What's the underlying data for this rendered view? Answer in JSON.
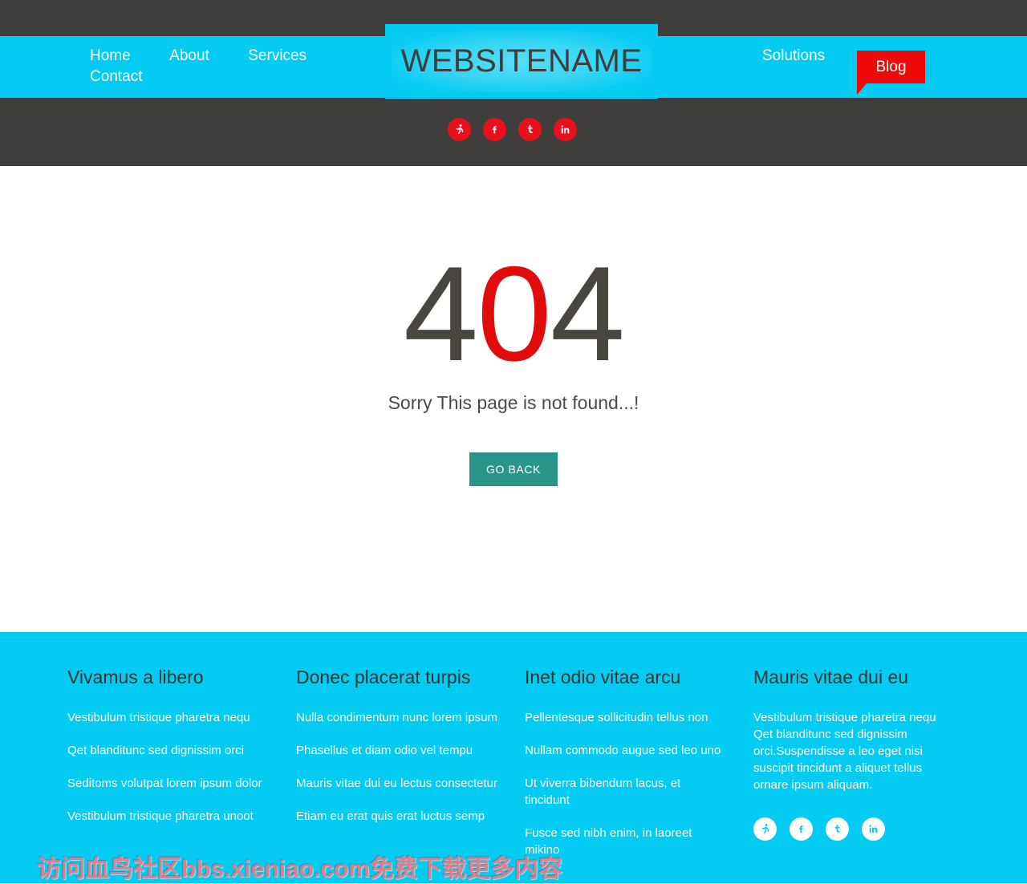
{
  "colors": {
    "cyan": "#04cbf2",
    "dark": "#403e3c",
    "red": "#ee0a0a",
    "social_red": "#e8111b",
    "teal": "#2a9488",
    "error_gray": "#49463f",
    "error_red": "#e20b0b",
    "white": "#ffffff"
  },
  "header": {
    "logo_text": "WEBSITENAME",
    "nav_left": [
      {
        "label": "Home",
        "name": "nav-home"
      },
      {
        "label": "About",
        "name": "nav-about"
      },
      {
        "label": "Services",
        "name": "nav-services"
      },
      {
        "label": "Contact",
        "name": "nav-contact"
      }
    ],
    "nav_right": [
      {
        "label": "Solutions",
        "name": "nav-solutions"
      }
    ],
    "blog_label": "Blog"
  },
  "social_top": [
    {
      "name": "runner-icon",
      "title": "Runner"
    },
    {
      "name": "facebook-icon",
      "title": "Facebook",
      "glyph": "f"
    },
    {
      "name": "twitter-icon",
      "title": "Twitter",
      "glyph": "t"
    },
    {
      "name": "linkedin-icon",
      "title": "LinkedIn",
      "glyph": "in"
    }
  ],
  "main": {
    "error_digit_1": "4",
    "error_digit_2": "0",
    "error_digit_3": "4",
    "message": "Sorry This page is not found...!",
    "go_back_label": "GO BACK"
  },
  "footer": {
    "columns": [
      {
        "title": "Vivamus a libero",
        "links": [
          "Vestibulum tristique pharetra nequ",
          "Qet blanditunc sed dignissim orci",
          "Seditoms volutpat lorem ipsum dolor",
          "Vestibulum tristique pharetra unoot"
        ]
      },
      {
        "title": "Donec placerat turpis",
        "links": [
          "Nulla condimentum nunc lorem ipsum",
          "Phasellus et diam odio vel tempu",
          "Mauris vitae dui eu lectus consectetur",
          "Etiam eu erat quis erat luctus semp"
        ]
      },
      {
        "title": "Inet odio vitae arcu",
        "links": [
          "Pellentesque sollicitudin tellus non",
          "Nullam commodo augue sed leo uno",
          "Ut viverra bibendum lacus, et tincidunt",
          "Fusce sed nibh enim, in laoreet mikino"
        ]
      },
      {
        "title": "Mauris vitae dui eu",
        "paragraph": "Vestibulum tristique pharetra nequ Qet blanditunc sed dignissim orci.Suspendisse a leo eget nisi suscipit tincidunt a aliquet tellus ornare ipsum aliquam."
      }
    ],
    "social": [
      {
        "name": "runner-icon",
        "title": "Runner"
      },
      {
        "name": "facebook-icon",
        "title": "Facebook",
        "glyph": "f"
      },
      {
        "name": "twitter-icon",
        "title": "Twitter",
        "glyph": "t"
      },
      {
        "name": "linkedin-icon",
        "title": "LinkedIn",
        "glyph": "in"
      }
    ]
  },
  "watermark": "访问血鸟社区bbs.xieniao.com免费下载更多内容"
}
